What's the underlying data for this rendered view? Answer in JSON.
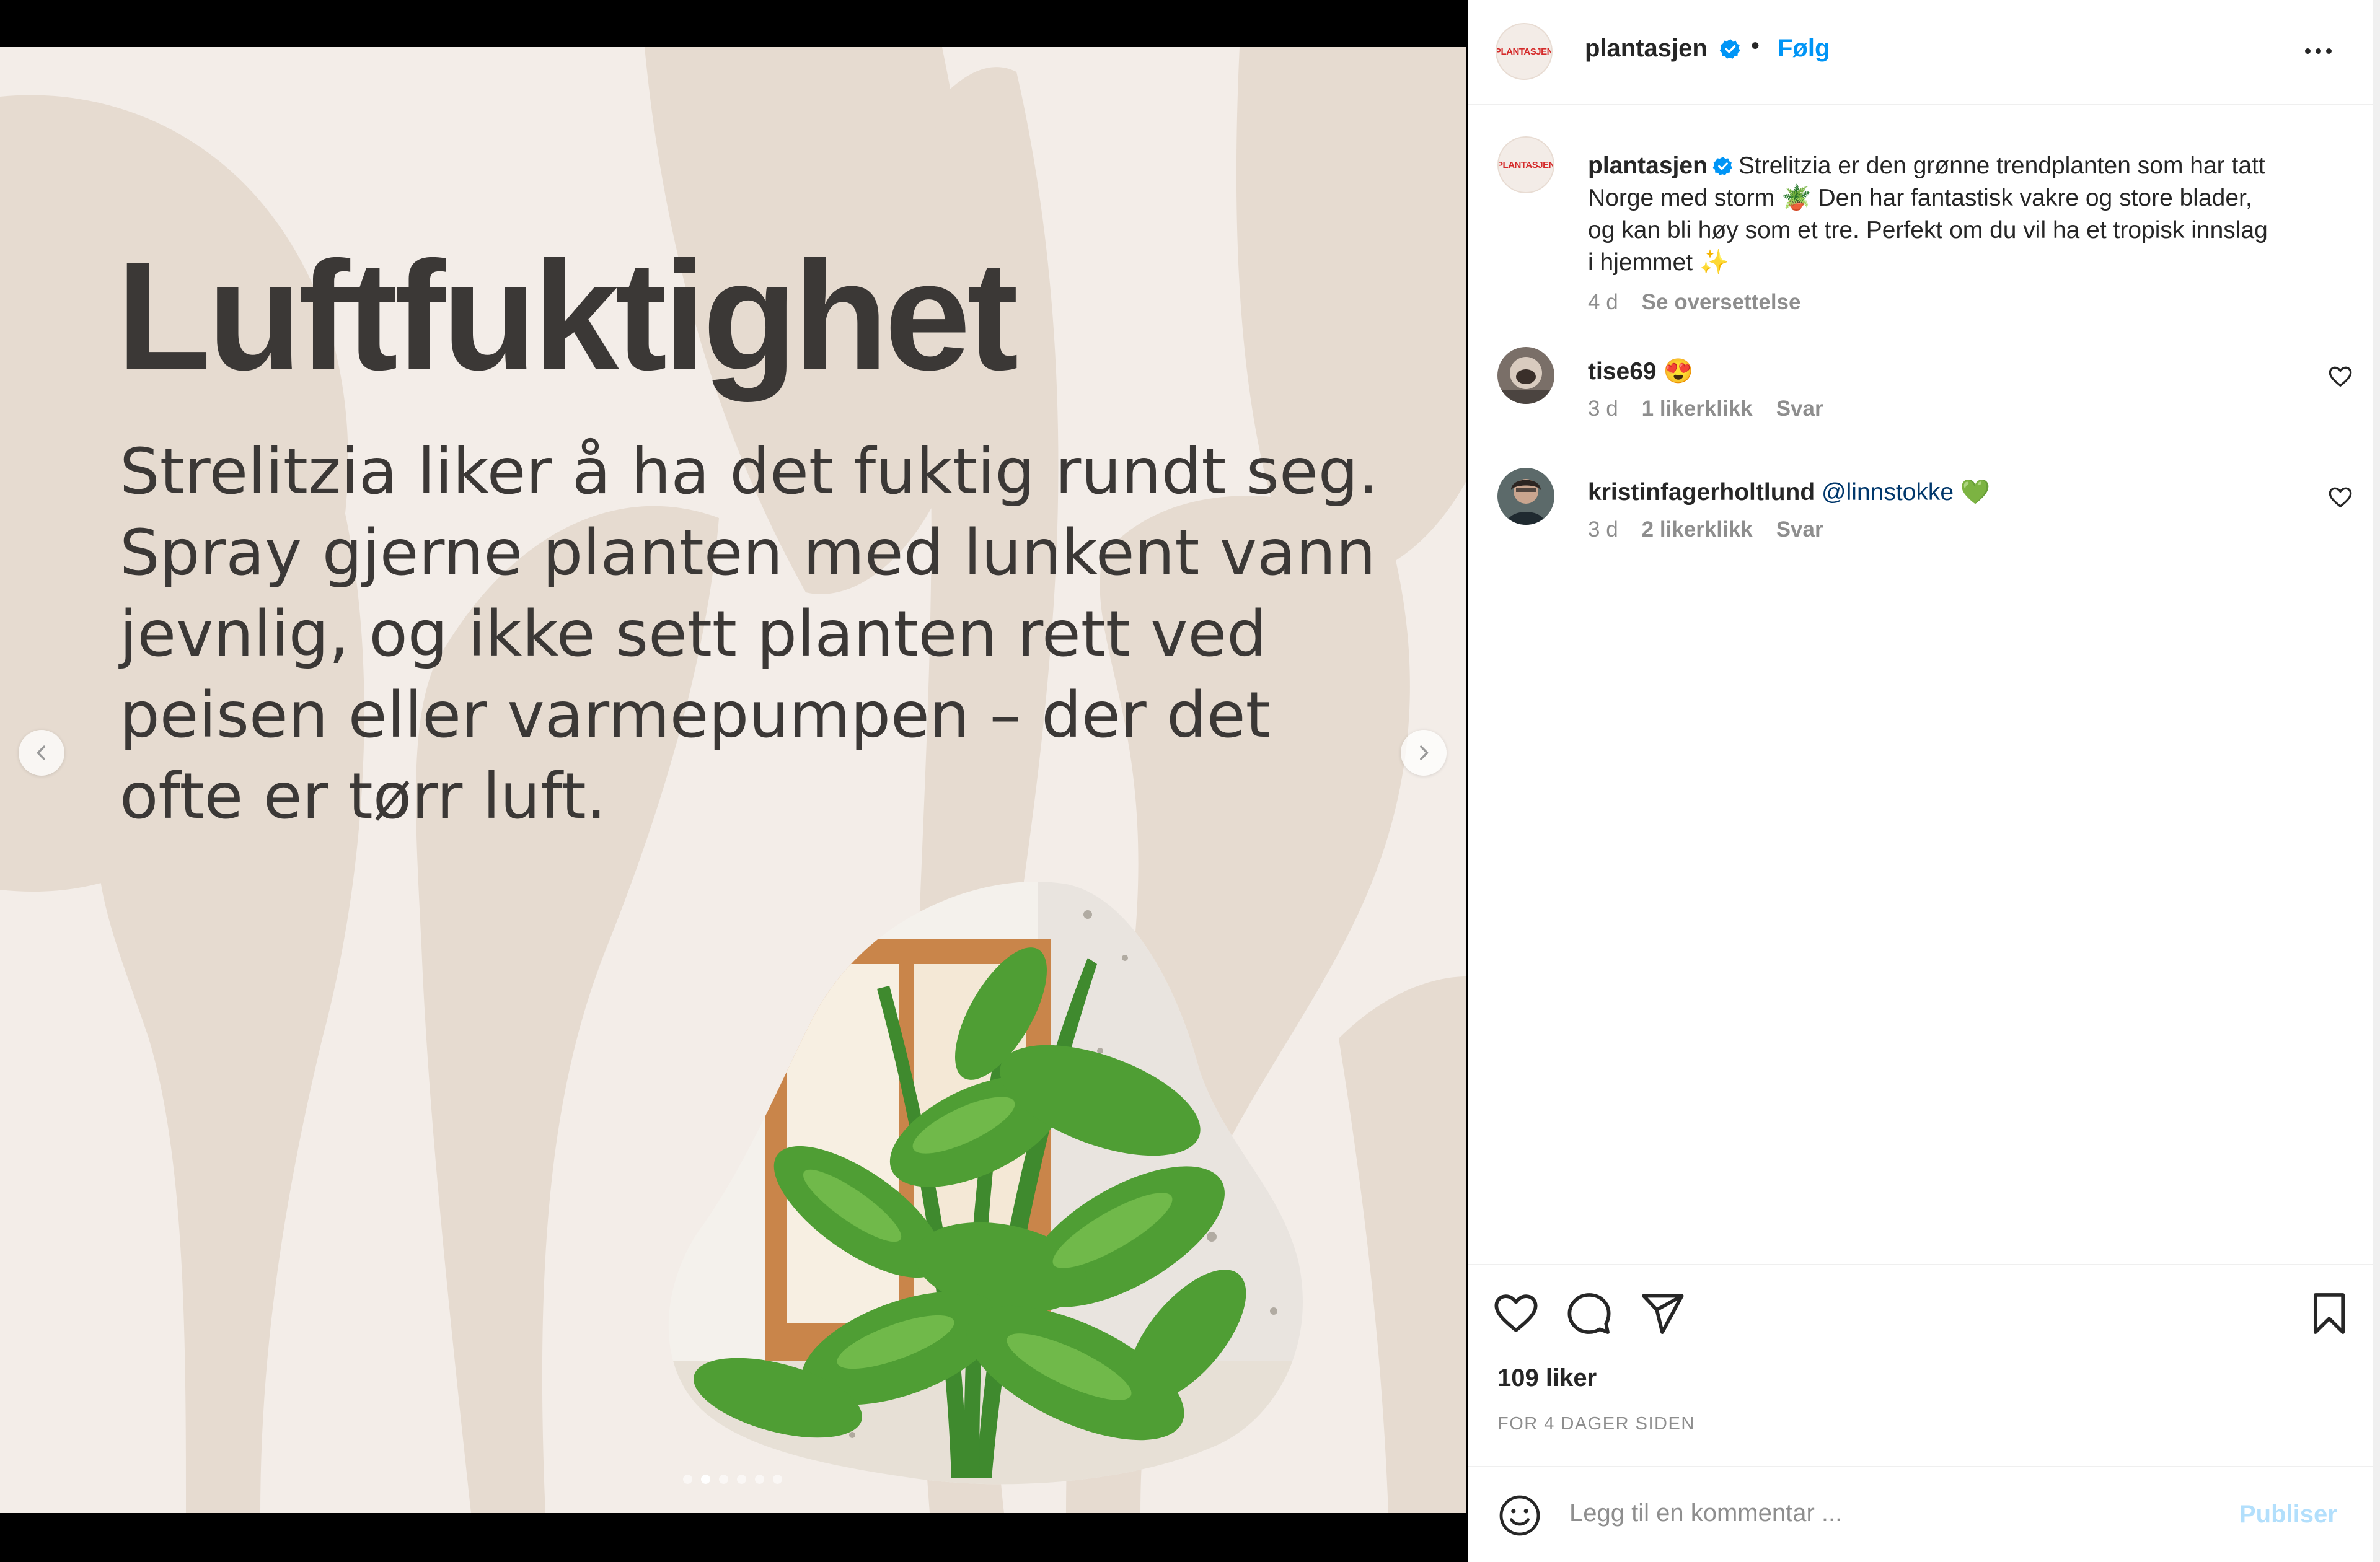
{
  "post": {
    "slide": {
      "title": "Luftfuktighet",
      "body": "Strelitzia liker å ha det fuktig rundt seg. Spray gjerne planten med lunkent vann jevnlig, og ikke sett planten rett ved peisen eller varmepumpen – der det ofte er tørr luft.",
      "slide_count": 6,
      "active_slide": 2
    },
    "header": {
      "brand_logo_text": "PLANTASJEN",
      "username": "plantasjen",
      "separator": "•",
      "follow_label": "Følg"
    },
    "caption": {
      "username": "plantasjen",
      "text": "Strelitzia er den grønne trendplanten som har tatt Norge med storm 🪴 Den har fantastisk vakre og store blader, og kan bli høy som et tre. Perfekt om du vil ha et tropisk innslag i hjemmet ✨",
      "time": "4 d",
      "translate_label": "Se oversettelse"
    },
    "comments": [
      {
        "username": "tise69",
        "text": "😍",
        "mention": "",
        "time": "3 d",
        "likes": "1 likerklikk",
        "reply_label": "Svar"
      },
      {
        "username": "kristinfagerholtlund",
        "text": " 💚",
        "mention": "@linnstokke",
        "time": "3 d",
        "likes": "2 likerklikk",
        "reply_label": "Svar"
      }
    ],
    "footer": {
      "likes": "109 liker",
      "date": "FOR 4 DAGER SIDEN"
    },
    "add_comment": {
      "placeholder": "Legg til en kommentar ...",
      "publish_label": "Publiser"
    }
  },
  "colors": {
    "link_blue": "#0095f6",
    "verified_blue": "#0095f6",
    "publish_disabled": "#b2dffc",
    "slide_bg": "#f3ede8",
    "leaf_shape": "#e6dbd0",
    "text_dark": "#3b3836"
  },
  "icons": [
    "chevron-left-icon",
    "chevron-right-icon",
    "verified-badge-icon",
    "more-icon",
    "heart-icon",
    "comment-icon",
    "share-icon",
    "bookmark-icon",
    "emoji-icon"
  ]
}
